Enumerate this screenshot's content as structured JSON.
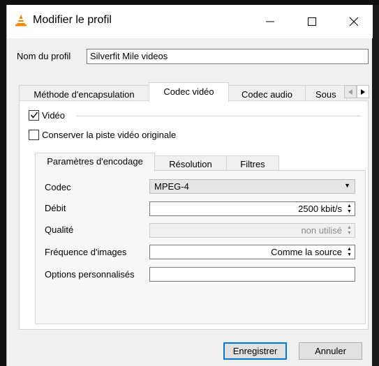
{
  "window": {
    "title": "Modifier le profil",
    "icon": "vlc-cone-icon"
  },
  "profile": {
    "label": "Nom du profil",
    "value": "Silverfit Mile videos"
  },
  "outer_tabs": [
    {
      "label": "Méthode d'encapsulation",
      "active": false
    },
    {
      "label": "Codec vidéo",
      "active": true
    },
    {
      "label": "Codec audio",
      "active": false
    },
    {
      "label": "Sous",
      "active": false
    }
  ],
  "video": {
    "enabled_label": "Vidéo",
    "enabled": true,
    "keep_original_label": "Conserver la piste vidéo originale",
    "keep_original": false
  },
  "inner_tabs": [
    {
      "label": "Paramètres d'encodage",
      "active": true
    },
    {
      "label": "Résolution",
      "active": false
    },
    {
      "label": "Filtres",
      "active": false
    }
  ],
  "encoding": {
    "codec_label": "Codec",
    "codec_value": "MPEG-4",
    "bitrate_label": "Débit",
    "bitrate_value": "2500 kbit/s",
    "quality_label": "Qualité",
    "quality_value": "non utilisé",
    "framerate_label": "Fréquence d'images",
    "framerate_value": "Comme la source",
    "custom_label": "Options personnalisés",
    "custom_value": ""
  },
  "buttons": {
    "save": "Enregistrer",
    "cancel": "Annuler"
  },
  "colors": {
    "accent": "#0078d7",
    "vlc_orange": "#f08a00"
  }
}
